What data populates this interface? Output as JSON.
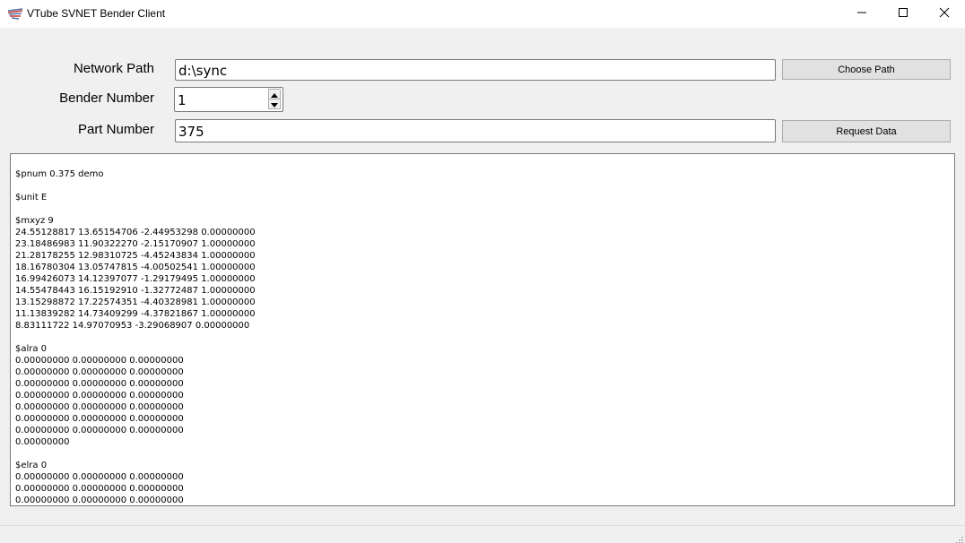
{
  "window": {
    "title": "VTube SVNET Bender Client"
  },
  "form": {
    "network_path_label": "Network Path",
    "network_path_value": "d:\\sync",
    "choose_path_button": "Choose Path",
    "bender_number_label": "Bender Number",
    "bender_number_value": "1",
    "part_number_label": "Part Number",
    "part_number_value": "375",
    "request_data_button": "Request Data"
  },
  "output": {
    "text": "$pnum 0.375 demo\n\n$unit E\n\n$mxyz 9\n24.55128817 13.65154706 -2.44953298 0.00000000\n23.18486983 11.90322270 -2.15170907 1.00000000\n21.28178255 12.98310725 -4.45243834 1.00000000\n18.16780304 13.05747815 -4.00502541 1.00000000\n16.99426073 14.12397077 -1.29179495 1.00000000\n14.55478443 16.15192910 -1.32772487 1.00000000\n13.15298872 17.22574351 -4.40328981 1.00000000\n11.13839282 14.73409299 -4.37821867 1.00000000\n8.83111722 14.97070953 -3.29068907 0.00000000\n\n$alra 0\n0.00000000 0.00000000 0.00000000\n0.00000000 0.00000000 0.00000000\n0.00000000 0.00000000 0.00000000\n0.00000000 0.00000000 0.00000000\n0.00000000 0.00000000 0.00000000\n0.00000000 0.00000000 0.00000000\n0.00000000 0.00000000 0.00000000\n0.00000000\n\n$elra 0\n0.00000000 0.00000000 0.00000000\n0.00000000 0.00000000 0.00000000\n0.00000000 0.00000000 0.00000000"
  },
  "icons": {
    "app": "app-logo-icon",
    "minimize": "minimize-icon",
    "maximize": "maximize-icon",
    "close": "close-icon",
    "spin_up": "spin-up-icon",
    "spin_down": "spin-down-icon",
    "resize_grip": "resize-grip-icon"
  },
  "colors": {
    "window_bg": "#f0f0f0",
    "titlebar_bg": "#ffffff",
    "button_bg": "#e1e1e1",
    "field_border": "#7a7a7a"
  }
}
